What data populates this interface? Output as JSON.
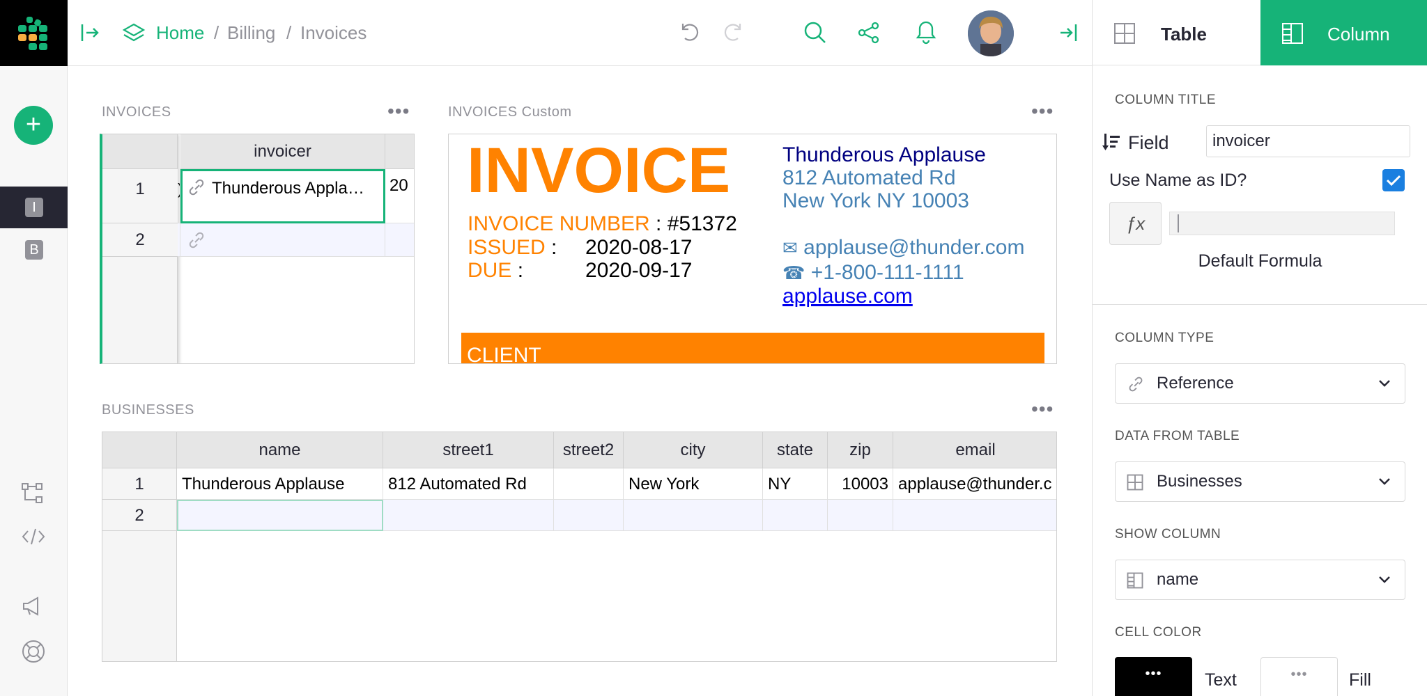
{
  "breadcrumb": {
    "home": "Home",
    "sep1": "/",
    "billing": "Billing",
    "sep2": "/",
    "invoices": "Invoices"
  },
  "pages": {
    "i_badge": "I",
    "b_badge": "B"
  },
  "add_label": "+",
  "right_panel": {
    "tab_table": "Table",
    "tab_column": "Column",
    "column_title_label": "COLUMN TITLE",
    "field_label": "Field",
    "field_value": "invoicer",
    "use_name_as_id": "Use Name as ID?",
    "fx_label": "ƒx",
    "default_formula": "Default Formula",
    "column_type_label": "COLUMN TYPE",
    "column_type": "Reference",
    "data_from_table_label": "DATA FROM TABLE",
    "data_from_table": "Businesses",
    "show_column_label": "SHOW COLUMN",
    "show_column": "name",
    "cell_color_label": "CELL COLOR",
    "text_swatch": "•••",
    "text_label": "Text",
    "fill_swatch": "•••",
    "fill_label": "Fill"
  },
  "invoices_widget": {
    "title": "INVOICES",
    "menu": "•••",
    "column_header": "invoicer",
    "rows": [
      {
        "num": "1",
        "left_fragment": ")",
        "invoicer": "Thunderous Appla…",
        "next": "20"
      },
      {
        "num": "2",
        "left_fragment": "",
        "invoicer": "",
        "next": ""
      }
    ]
  },
  "custom_widget": {
    "title": "INVOICES Custom",
    "menu": "•••",
    "heading": "INVOICE",
    "number_label": "INVOICE NUMBER",
    "number_sep": ":",
    "number_value": "#51372",
    "issued_label": "ISSUED",
    "issued_sep": ":",
    "issued_value": "2020-08-17",
    "due_label": "DUE",
    "due_sep": ":",
    "due_value": "2020-09-17",
    "biz_name": "Thunderous Applause",
    "biz_street": "812 Automated Rd",
    "biz_city": "New York NY 10003",
    "email_icon": "✉",
    "email": "applause@thunder.com",
    "phone_icon": "☎",
    "phone": "+1-800-111-1111",
    "website": "applause.com",
    "client_banner": "CLIENT",
    "colors": {
      "orange": "#ff8200",
      "navy": "#000080",
      "steel": "#4682b4"
    }
  },
  "businesses_widget": {
    "title": "BUSINESSES",
    "menu": "•••",
    "headers": [
      "name",
      "street1",
      "street2",
      "city",
      "state",
      "zip",
      "email"
    ],
    "rows": [
      {
        "num": "1",
        "cells": [
          "Thunderous Applause",
          "812 Automated Rd",
          "",
          "New York",
          "NY",
          "10003",
          "applause@thunder.c"
        ]
      },
      {
        "num": "2",
        "cells": [
          "",
          "",
          "",
          "",
          "",
          "",
          ""
        ]
      }
    ]
  },
  "colors": {
    "accent": "#16b378",
    "dark": "#262633"
  }
}
